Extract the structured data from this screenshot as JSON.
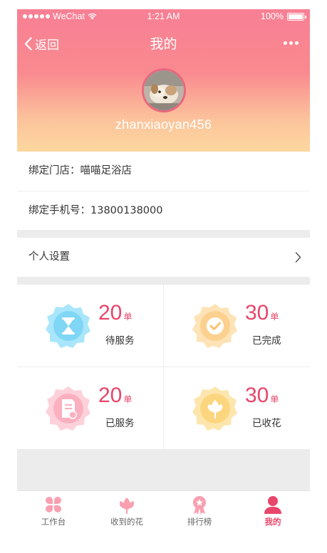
{
  "status_bar": {
    "carrier": "WeChat",
    "time": "1:21 AM",
    "battery": "100%"
  },
  "nav": {
    "back_label": "返回",
    "title": "我的"
  },
  "profile": {
    "username": "zhanxiaoyan456"
  },
  "info": {
    "store_label": "绑定门店：",
    "store_value": "喵喵足浴店",
    "phone_label": "绑定手机号：",
    "phone_value": "13800138000"
  },
  "settings": {
    "label": "个人设置"
  },
  "stats": [
    {
      "value": "20",
      "unit": "单",
      "label": "待服务",
      "icon": "hourglass-icon",
      "color": "#7fd6f5"
    },
    {
      "value": "30",
      "unit": "单",
      "label": "已完成",
      "icon": "check-icon",
      "color": "#fcd08e"
    },
    {
      "value": "20",
      "unit": "单",
      "label": "已服务",
      "icon": "document-icon",
      "color": "#fbb0bf"
    },
    {
      "value": "30",
      "unit": "单",
      "label": "已收花",
      "icon": "flower-icon",
      "color": "#fcd57f"
    }
  ],
  "tabs": [
    {
      "label": "工作台",
      "icon": "workbench-icon"
    },
    {
      "label": "收到的花",
      "icon": "flower-icon"
    },
    {
      "label": "排行榜",
      "icon": "ranking-icon"
    },
    {
      "label": "我的",
      "icon": "user-icon",
      "active": true
    }
  ],
  "colors": {
    "accent": "#e8466a",
    "header_top": "#f87f94",
    "header_bottom": "#fcd79e"
  }
}
